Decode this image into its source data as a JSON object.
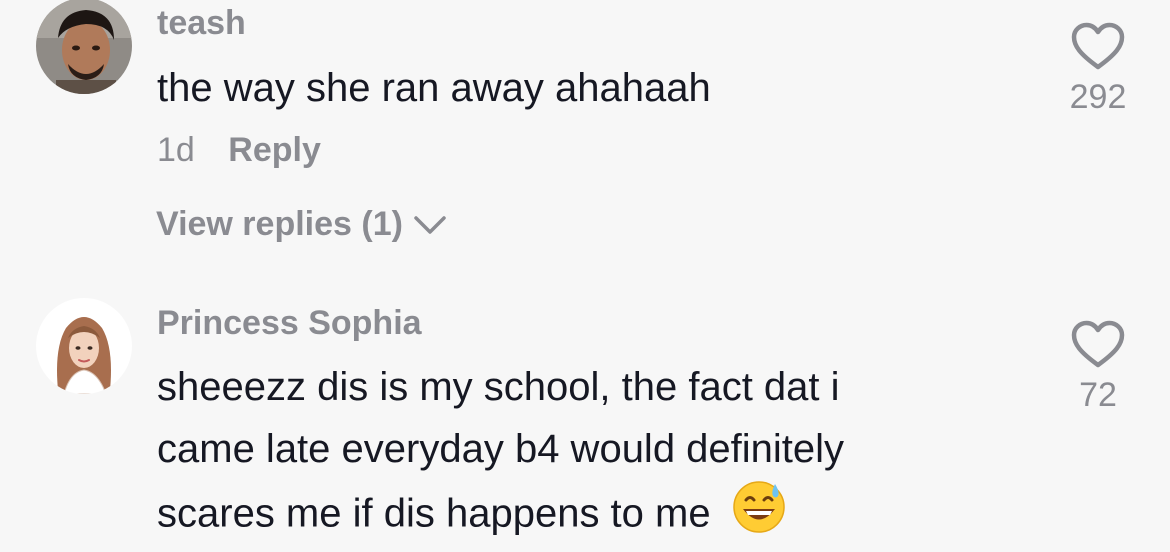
{
  "comments": [
    {
      "username": "teash",
      "text": "the way she ran away ahahaah",
      "time": "1d",
      "reply_label": "Reply",
      "view_replies": "View replies (1)",
      "likes": "292",
      "avatar_icon": "man-avatar"
    },
    {
      "username": "Princess Sophia",
      "text_lines": [
        "sheeezz dis is my school, the fact dat i",
        "came late everyday b4 would definitely",
        "scares me if dis happens to me"
      ],
      "emoji_icon": "grinning-sweat-emoji",
      "likes": "72",
      "avatar_icon": "hijab-woman-avatar"
    }
  ],
  "colors": {
    "background": "#f7f7f7",
    "primary_text": "#161823",
    "secondary_text": "#8a8b91"
  }
}
